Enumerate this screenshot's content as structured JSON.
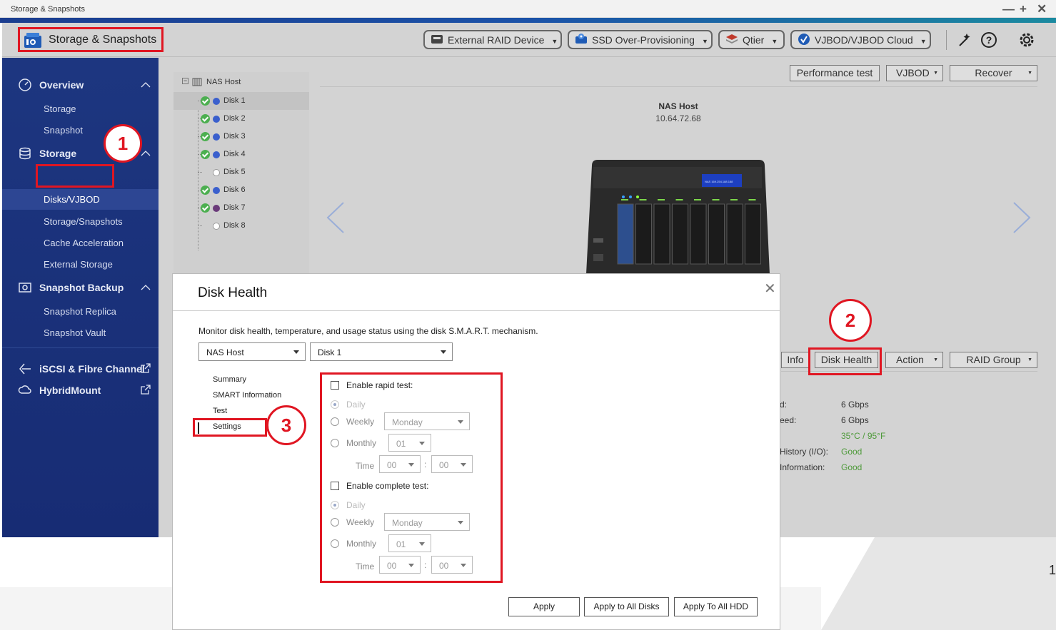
{
  "window": {
    "title": "Storage & Snapshots"
  },
  "header": {
    "app_title": "Storage & Snapshots",
    "buttons": [
      {
        "label": "External RAID Device",
        "icon": "ssd-icon"
      },
      {
        "label": "SSD Over-Provisioning",
        "icon": "ssd-gear-icon"
      },
      {
        "label": "Qtier",
        "icon": "tier-stack-icon"
      },
      {
        "label": "VJBOD/VJBOD Cloud",
        "icon": "vjbod-icon"
      }
    ]
  },
  "sidebar": {
    "groups": [
      {
        "label": "Overview",
        "icon": "gauge-icon",
        "items": [
          "Storage",
          "Snapshot"
        ]
      },
      {
        "label": "Storage",
        "icon": "database-icon",
        "items": [
          "Disks/VJBOD",
          "Storage/Snapshots",
          "Cache Acceleration",
          "External Storage"
        ]
      },
      {
        "label": "Snapshot Backup",
        "icon": "snapshot-backup-icon",
        "items": [
          "Snapshot Replica",
          "Snapshot Vault"
        ]
      }
    ],
    "links": [
      {
        "label": "iSCSI & Fibre Channel",
        "icon": "iscsi-icon"
      },
      {
        "label": "HybridMount",
        "icon": "cloud-mount-icon"
      }
    ],
    "active_item": "Disks/VJBOD"
  },
  "toolbar": {
    "performance_test": "Performance test",
    "vjbod": "VJBOD",
    "recover": "Recover"
  },
  "tree": {
    "root": "NAS Host",
    "disks": [
      {
        "label": "Disk 1",
        "ok": true,
        "color": "#3a5fcd"
      },
      {
        "label": "Disk 2",
        "ok": true,
        "color": "#3a5fcd"
      },
      {
        "label": "Disk 3",
        "ok": true,
        "color": "#3a5fcd"
      },
      {
        "label": "Disk 4",
        "ok": true,
        "color": "#3a5fcd"
      },
      {
        "label": "Disk 5",
        "ok": false,
        "color": "#ffffff"
      },
      {
        "label": "Disk 6",
        "ok": true,
        "color": "#3a5fcd"
      },
      {
        "label": "Disk 7",
        "ok": true,
        "color": "#6a3a7a"
      },
      {
        "label": "Disk 8",
        "ok": false,
        "color": "#ffffff"
      }
    ]
  },
  "device": {
    "name": "NAS Host",
    "ip": "10.64.72.68",
    "lcd": "NAS 169.254.188.188"
  },
  "disk_actions": {
    "info": "Info",
    "disk_health": "Disk Health",
    "action": "Action",
    "raid_group": "RAID Group"
  },
  "disk_info": {
    "rows": [
      {
        "label": "d:",
        "value": "6 Gbps",
        "good": false
      },
      {
        "label": "eed:",
        "value": "6 Gbps",
        "good": false
      },
      {
        "label": "",
        "value": "35°C / 95°F",
        "good": true
      },
      {
        "label": "History (I/O):",
        "value": "Good",
        "good": true
      },
      {
        "label": "Information:",
        "value": "Good",
        "good": true
      }
    ]
  },
  "dialog": {
    "title": "Disk Health",
    "description": "Monitor disk health, temperature, and usage status using the disk S.M.A.R.T. mechanism.",
    "host_select": "NAS Host",
    "disk_select": "Disk 1",
    "tabs": [
      "Summary",
      "SMART Information",
      "Test",
      "Settings"
    ],
    "active_tab": "Settings",
    "rapid": {
      "enable_label": "Enable rapid test:",
      "daily": "Daily",
      "weekly": "Weekly",
      "weekly_day": "Monday",
      "monthly": "Monthly",
      "monthly_day": "01",
      "time_label": "Time",
      "hour": "00",
      "minute": "00",
      "colon": ":"
    },
    "complete": {
      "enable_label": "Enable complete test:",
      "daily": "Daily",
      "weekly": "Weekly",
      "weekly_day": "Monday",
      "monthly": "Monthly",
      "monthly_day": "01",
      "time_label": "Time",
      "hour": "00",
      "minute": "00",
      "colon": ":"
    },
    "buttons": {
      "apply": "Apply",
      "apply_all_disks": "Apply to All Disks",
      "apply_all_hdd": "Apply To All HDD"
    }
  },
  "callouts": [
    "1",
    "2",
    "3"
  ],
  "stray_text": "1"
}
